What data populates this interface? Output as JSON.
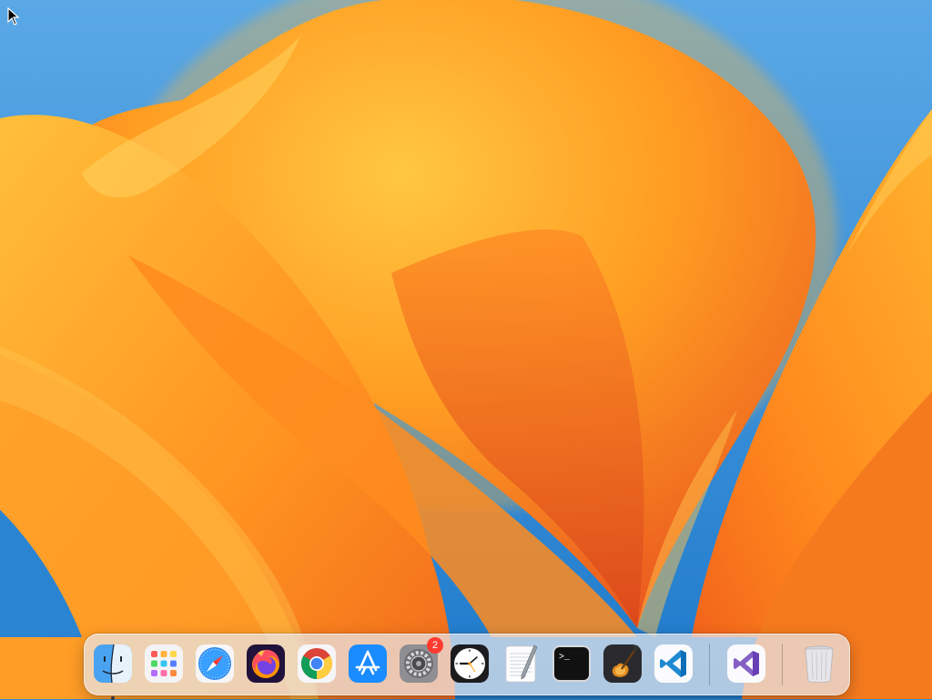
{
  "desktop": {
    "wallpaper": "macOS Ventura",
    "colors": {
      "sky_top": "#5aa8e6",
      "sky_bottom": "#1f7acb",
      "petal_light": "#ffc742",
      "petal_mid": "#ff9a1f",
      "petal_deep": "#e8531f"
    }
  },
  "dock": {
    "items": [
      {
        "id": "finder",
        "icon": "finder-icon",
        "running": true
      },
      {
        "id": "launchpad",
        "icon": "launchpad-icon"
      },
      {
        "id": "safari",
        "icon": "safari-icon"
      },
      {
        "id": "firefox",
        "icon": "firefox-icon"
      },
      {
        "id": "chrome",
        "icon": "chrome-icon"
      },
      {
        "id": "app-store",
        "icon": "app-store-icon"
      },
      {
        "id": "system-settings",
        "icon": "system-settings-icon",
        "badge": "2"
      },
      {
        "id": "clock",
        "icon": "clock-icon"
      },
      {
        "id": "textedit",
        "icon": "textedit-icon"
      },
      {
        "id": "terminal",
        "icon": "terminal-icon",
        "glyph": ">_"
      },
      {
        "id": "garageband",
        "icon": "garageband-icon"
      },
      {
        "id": "vscode",
        "icon": "vscode-icon"
      },
      {
        "id": "visual-studio",
        "icon": "visual-studio-icon"
      },
      {
        "id": "trash",
        "icon": "trash-icon"
      }
    ]
  }
}
